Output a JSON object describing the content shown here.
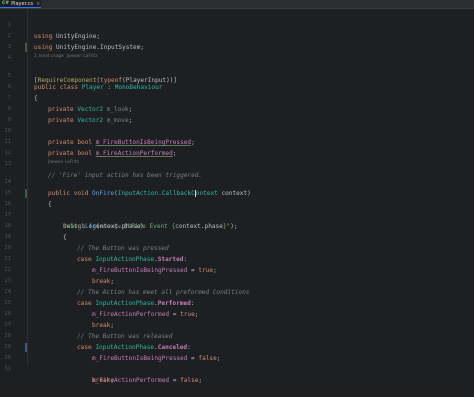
{
  "tab": {
    "badge": "C#",
    "filename": "Player.cs",
    "close": "×"
  },
  "hints": {
    "usage": "1 asset usage",
    "author": "Jaewon LaFritz",
    "author2": "Jaewon LaFritz"
  },
  "lines": {
    "n1": "1",
    "n2": "2",
    "n3": "3",
    "n4": "4",
    "n5": "5",
    "n6": "6",
    "n7": "7",
    "n8": "8",
    "n9": "9",
    "n10": "10",
    "n11": "11",
    "n12": "12",
    "n13": "13",
    "n14": "14",
    "n15": "15",
    "n16": "16",
    "n17": "17",
    "n18": "18",
    "n19": "19",
    "n20": "20",
    "n21": "21",
    "n22": "22",
    "n23": "23",
    "n24": "24",
    "n25": "25",
    "n26": "26",
    "n27": "27",
    "n28": "28",
    "n29": "29",
    "n30": "30",
    "n31": "31",
    "n32": "32",
    "n33": "33"
  },
  "code": {
    "using": "using",
    "ns1": "UnityEngine",
    "ns2": "UnityEngine.InputSystem",
    "semi": ";",
    "attr_open": "[",
    "attr_name": "RequireComponent",
    "attr_paren": "(",
    "typeof": "typeof",
    "attr_arg": "(PlayerInput)",
    "attr_close": ")]",
    "public": "public",
    "class": "class",
    "class_name": "Player",
    "colon": " : ",
    "base": "MonoBehaviour",
    "brace_open": "{",
    "brace_close": "}",
    "private": "private",
    "vector2": "Vector2",
    "bool": "bool",
    "f_look": "m_look",
    "f_move": "m_move",
    "f_fire_pressed": "m_FireButtonIsBeingPressed",
    "f_fire_performed": "m_FireActionPerformed",
    "c_fire": "// 'Fire' input action has been triggered.",
    "void": "void",
    "on_fire": "OnFire",
    "param_type_a": "InputAction.CallbackC",
    "param_type_b": "ontext",
    "param_name": " context)",
    "open_paren": "(",
    "debug": "Debug",
    "log": "Log",
    "message_hint": "message:",
    "log_str_a": "$\"Fire Event {",
    "log_str_ctx": "context.phase",
    "log_str_b": "}\"",
    "log_close": ");",
    "switch": "switch",
    "switch_arg": " (context.phase)",
    "c_pressed": "// The Button was pressed",
    "case": "case",
    "phase_type": "InputActionPhase",
    "started": "Started",
    "performed": "Performed",
    "canceled": "Canceled",
    "assign": " = ",
    "true": "true",
    "false": "false",
    "break": "break",
    "c_met": "// The Action has meet all preformed Conditions",
    "c_released": "// The Button was released",
    "dot": ".",
    "col": ":"
  }
}
